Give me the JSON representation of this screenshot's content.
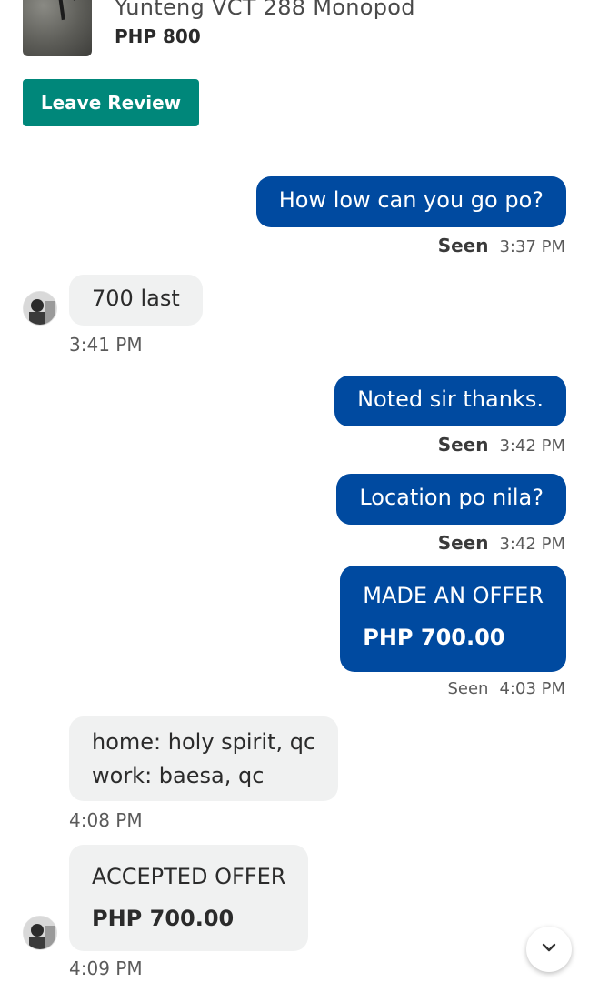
{
  "product": {
    "title": "Yunteng VCT 288 Monopod",
    "price": "PHP 800"
  },
  "actions": {
    "leave_review": "Leave Review"
  },
  "messages": [
    {
      "direction": "outgoing",
      "text": "How low can you go po?",
      "status": "Seen",
      "time": "3:37 PM"
    },
    {
      "direction": "incoming",
      "text": "700 last",
      "time": "3:41 PM",
      "avatar": true
    },
    {
      "direction": "outgoing",
      "text": "Noted sir thanks.",
      "status": "Seen",
      "time": "3:42 PM"
    },
    {
      "direction": "outgoing",
      "text": "Location po nila?",
      "status": "Seen",
      "time": "3:42 PM"
    },
    {
      "direction": "outgoing",
      "type": "offer",
      "title": "MADE AN OFFER",
      "amount": "PHP 700.00",
      "status": "Seen",
      "time": "4:03 PM"
    },
    {
      "direction": "incoming",
      "lines": [
        "home: holy spirit, qc",
        "work: baesa, qc"
      ],
      "time": "4:08 PM"
    },
    {
      "direction": "incoming",
      "type": "offer",
      "title": "ACCEPTED OFFER",
      "amount": "PHP 700.00",
      "time": "4:09 PM",
      "avatar": true
    }
  ],
  "icons": {
    "scroll_down": "chevron-down-icon",
    "avatar": "user-avatar"
  },
  "colors": {
    "primary_button": "#00877a",
    "outgoing_bubble": "#004aa0",
    "incoming_bubble": "#f0f1f1"
  }
}
